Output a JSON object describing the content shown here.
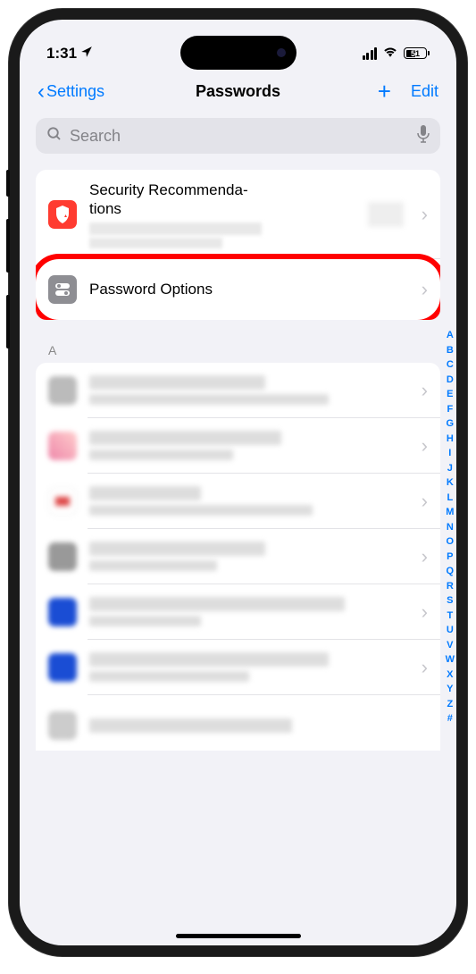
{
  "status": {
    "time": "1:31",
    "battery": "51"
  },
  "nav": {
    "back": "Settings",
    "title": "Passwords",
    "edit": "Edit"
  },
  "search": {
    "placeholder": "Search"
  },
  "rows": {
    "security": "Security Recommenda-\ntions",
    "options": "Password Options"
  },
  "section_a": "A",
  "alpha_index": [
    "A",
    "B",
    "C",
    "D",
    "E",
    "F",
    "G",
    "H",
    "I",
    "J",
    "K",
    "L",
    "M",
    "N",
    "O",
    "P",
    "Q",
    "R",
    "S",
    "T",
    "U",
    "V",
    "W",
    "X",
    "Y",
    "Z",
    "#"
  ]
}
